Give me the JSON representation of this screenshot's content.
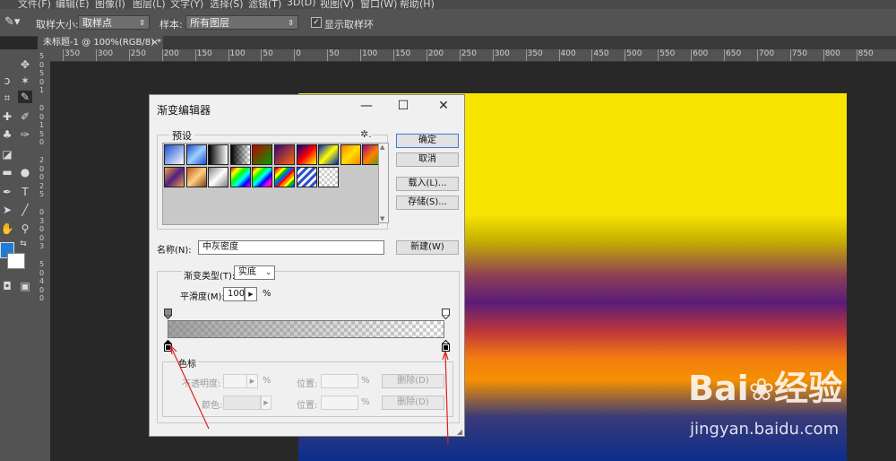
{
  "menubar": {
    "items": [
      "文件(F)",
      "编辑(E)",
      "图像(I)",
      "图层(L)",
      "文字(Y)",
      "选择(S)",
      "滤镜(T)",
      "3D(D)",
      "视图(V)",
      "窗口(W)",
      "帮助(H)"
    ]
  },
  "options": {
    "sample_size_label": "取样大小:",
    "sample_size_value": "取样点",
    "sample_label": "样本:",
    "sample_value": "所有图层",
    "show_ring_label": "显示取样环",
    "show_ring_checked": true
  },
  "document": {
    "tab_title": "未标题-1 @ 100%(RGB/8) *",
    "ruler_ticks": [
      "350",
      "300",
      "250",
      "200",
      "150",
      "100",
      "50",
      "0",
      "50",
      "100",
      "150",
      "200",
      "250",
      "300",
      "350",
      "400",
      "450",
      "500",
      "550",
      "600",
      "650",
      "700",
      "750",
      "800",
      "850"
    ],
    "vruler_ticks": [
      "5",
      "0",
      "5",
      "0",
      "1",
      "0",
      "0",
      "1",
      "5",
      "0",
      "2",
      "0",
      "0",
      "2",
      "5",
      "0",
      "3",
      "0",
      "0",
      "3",
      "5",
      "0",
      "4",
      "0",
      "0"
    ]
  },
  "colors": {
    "foreground": "#1f7bd4",
    "background": "#ffffff"
  },
  "dialog": {
    "title": "渐变编辑器",
    "presets_label": "预设",
    "ok": "确定",
    "cancel": "取消",
    "load": "载入(L)...",
    "save": "存储(S)...",
    "name_label": "名称(N):",
    "name_value": "中灰密度",
    "new_button": "新建(W)",
    "gradient_type_label": "渐变类型(T):",
    "gradient_type_value": "实底",
    "smoothness_label": "平滑度(M):",
    "smoothness_value": "100",
    "smoothness_unit": "%",
    "stops_label": "色标",
    "opacity_label": "不透明度:",
    "opacity_unit": "%",
    "location_label_1": "位置:",
    "location_unit_1": "%",
    "delete_1": "删除(D)",
    "color_label": "颜色:",
    "location_label_2": "位置:",
    "location_unit_2": "%",
    "delete_2": "删除(D)"
  },
  "watermark": {
    "brand_a": "Bai",
    "brand_b": "经验",
    "url": "jingyan.baidu.com"
  }
}
